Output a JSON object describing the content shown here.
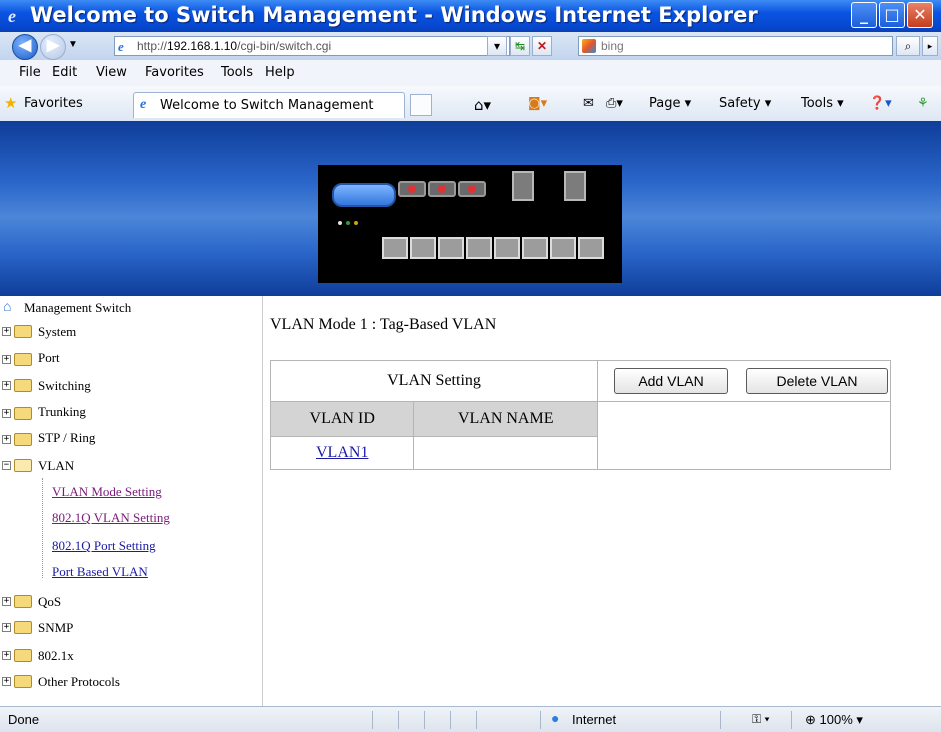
{
  "window": {
    "title": "Welcome to Switch Management - Windows Internet Explorer"
  },
  "address_bar": {
    "url_prefix": "http://",
    "url_host": "192.168.1.10",
    "url_path": "/cgi-bin/switch.cgi",
    "search_placeholder": "bing"
  },
  "menu": [
    "File",
    "Edit",
    "View",
    "Favorites",
    "Tools",
    "Help"
  ],
  "favorites_bar": {
    "favorites_label": "Favorites",
    "tab_title": "Welcome to Switch Management",
    "commands": [
      "Page",
      "Safety",
      "Tools"
    ]
  },
  "sidebar": {
    "root_label": "Management Switch",
    "items": [
      {
        "label": "System",
        "expanded": false
      },
      {
        "label": "Port",
        "expanded": false
      },
      {
        "label": "Switching",
        "expanded": false
      },
      {
        "label": "Trunking",
        "expanded": false
      },
      {
        "label": "STP / Ring",
        "expanded": false
      },
      {
        "label": "VLAN",
        "expanded": true
      }
    ],
    "vlan_children": [
      {
        "label": "VLAN Mode Setting",
        "visited": true
      },
      {
        "label": "802.1Q VLAN Setting",
        "visited": true
      },
      {
        "label": "802.1Q Port Setting",
        "visited": false
      },
      {
        "label": "Port Based VLAN",
        "visited": false
      }
    ],
    "items_after": [
      {
        "label": "QoS"
      },
      {
        "label": "SNMP"
      },
      {
        "label": "802.1x"
      },
      {
        "label": "Other Protocols"
      }
    ]
  },
  "main": {
    "mode_header": "VLAN Mode 1 : Tag-Based VLAN",
    "setting_label": "VLAN Setting",
    "add_button": "Add VLAN",
    "delete_button": "Delete VLAN",
    "columns": [
      "VLAN ID",
      "VLAN NAME"
    ],
    "rows": [
      {
        "id": "VLAN1",
        "name": ""
      }
    ]
  },
  "status_bar": {
    "status": "Done",
    "zone": "Internet",
    "zoom": "100%"
  },
  "colors": {
    "titlebar": "#0a54e2",
    "banner": "#2a66c9",
    "table_header_bg": "#d4d4d4",
    "link": "#1a1aa6",
    "visited_link": "#7a1a7a"
  }
}
